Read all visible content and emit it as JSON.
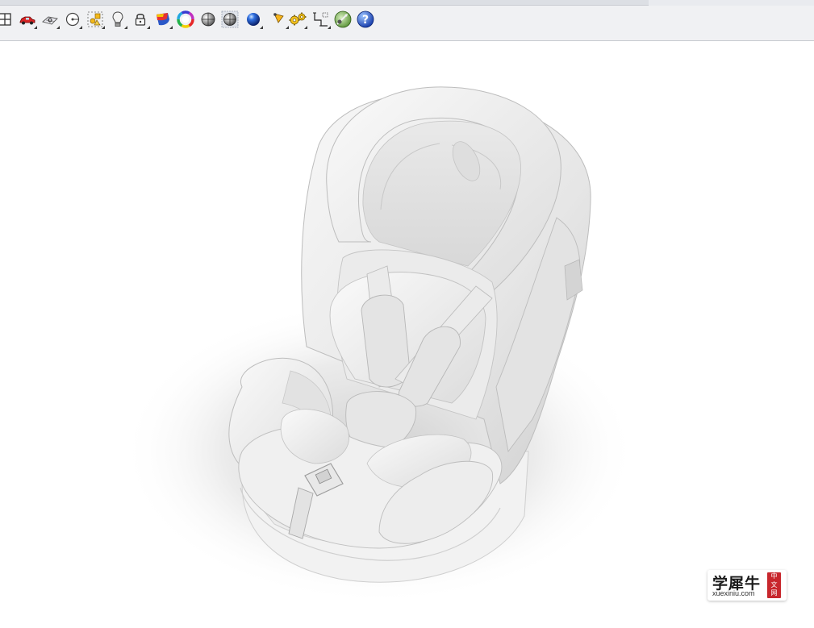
{
  "toolbar": {
    "icons": [
      {
        "name": "viewport-layout-icon"
      },
      {
        "name": "car-camera-icon"
      },
      {
        "name": "cplane-icon"
      },
      {
        "name": "target-icon"
      },
      {
        "name": "shapes-icon"
      },
      {
        "name": "light-bulb-icon"
      },
      {
        "name": "lock-icon"
      },
      {
        "name": "material-icon"
      },
      {
        "name": "color-wheel-icon"
      },
      {
        "name": "shaded-sphere-icon"
      },
      {
        "name": "render-sphere-icon"
      },
      {
        "name": "blue-sphere-icon"
      },
      {
        "name": "spotlight-icon"
      },
      {
        "name": "gear-options-icon"
      },
      {
        "name": "dimension-icon"
      },
      {
        "name": "ray-trace-icon"
      },
      {
        "name": "help-icon"
      }
    ]
  },
  "watermark": {
    "brand_cn": "学犀牛",
    "domain": "xuexiniu.com",
    "seal_text": "中文网"
  },
  "colors": {
    "toolbar_bg": "#f0f1f3",
    "viewport_bg": "#ffffff",
    "seal_red": "#c8272d"
  }
}
